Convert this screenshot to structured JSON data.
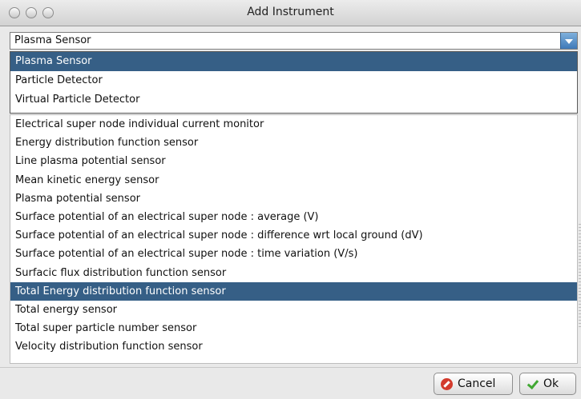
{
  "window": {
    "title": "Add Instrument"
  },
  "combo": {
    "selected": "Plasma Sensor"
  },
  "popup_options": [
    {
      "label": "Plasma Sensor",
      "selected": true
    },
    {
      "label": "Particle Detector",
      "selected": false
    },
    {
      "label": "Virtual Particle Detector",
      "selected": false
    }
  ],
  "instruments": [
    {
      "label": "Electrical super node individual current monitor",
      "selected": false
    },
    {
      "label": "Energy distribution function sensor",
      "selected": false
    },
    {
      "label": "Line plasma potential sensor",
      "selected": false
    },
    {
      "label": "Mean kinetic energy sensor",
      "selected": false
    },
    {
      "label": "Plasma potential sensor",
      "selected": false
    },
    {
      "label": "Surface potential of an electrical super node : average (V)",
      "selected": false
    },
    {
      "label": "Surface potential of an electrical super node : difference wrt local ground (dV)",
      "selected": false
    },
    {
      "label": "Surface potential of an electrical super node : time variation (V/s)",
      "selected": false
    },
    {
      "label": "Surfacic flux distribution function sensor",
      "selected": false
    },
    {
      "label": "Total Energy distribution function sensor",
      "selected": true
    },
    {
      "label": "Total energy sensor",
      "selected": false
    },
    {
      "label": "Total super particle number sensor",
      "selected": false
    },
    {
      "label": "Velocity distribution function sensor",
      "selected": false
    }
  ],
  "buttons": {
    "cancel": "Cancel",
    "ok": "Ok"
  },
  "colors": {
    "selection": "#365f86",
    "combo_button": "#3f79b8"
  },
  "icons": {
    "cancel": "cancel-icon",
    "ok": "checkmark-icon"
  }
}
